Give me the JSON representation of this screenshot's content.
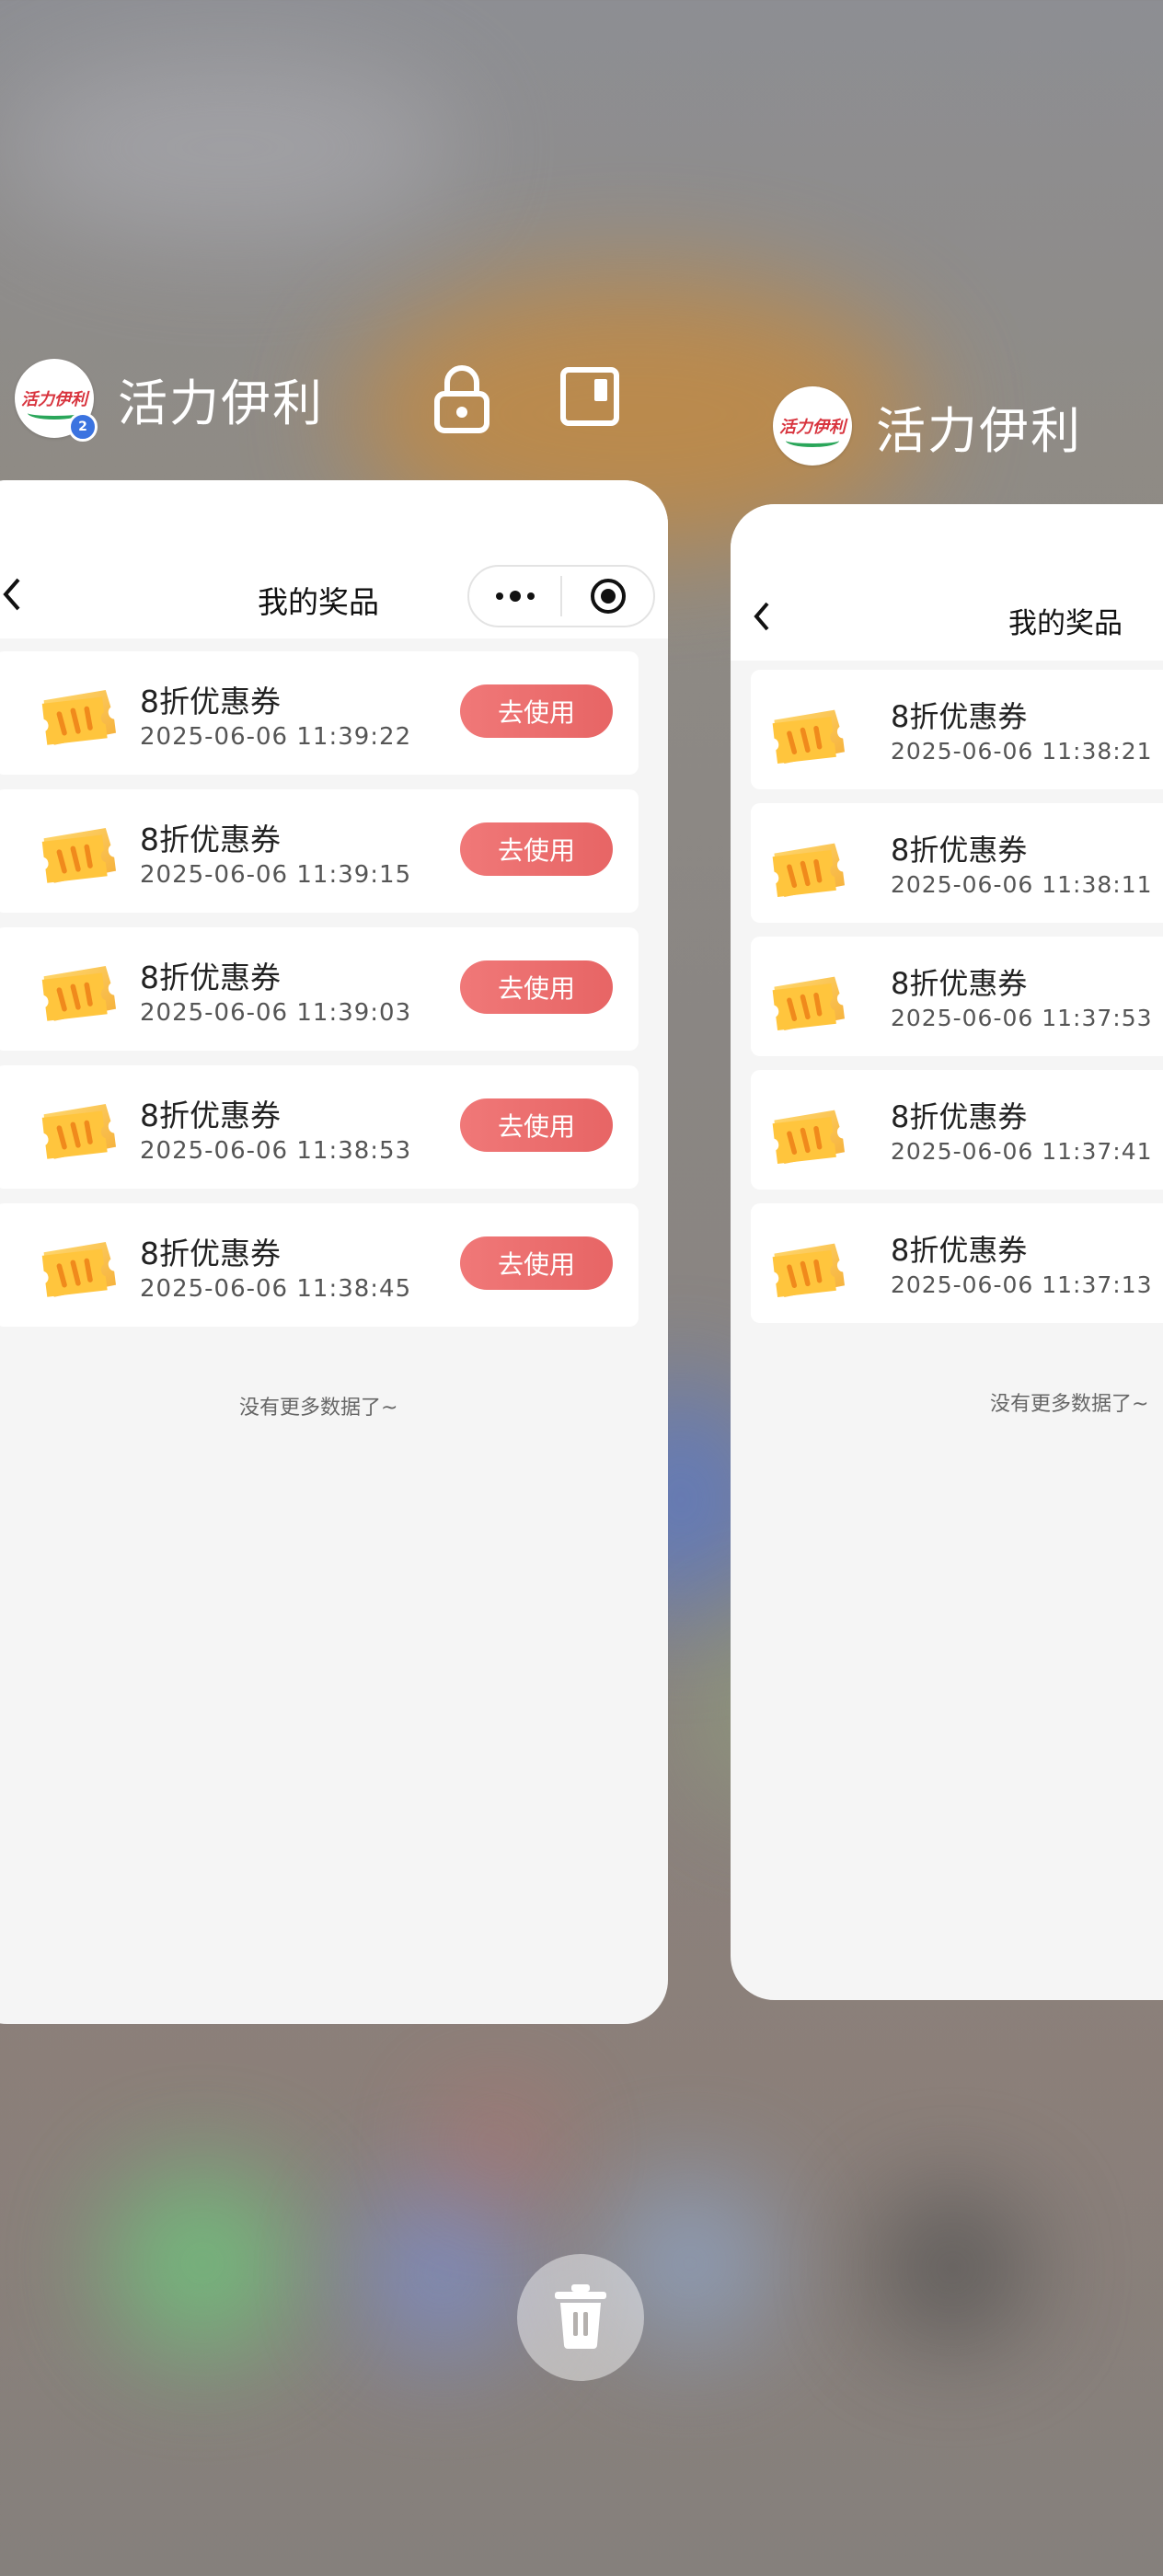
{
  "app": {
    "name": "活力伊利",
    "logo_text": "活力伊利",
    "badge": "2",
    "icons": [
      "lock-icon",
      "split-screen-icon"
    ]
  },
  "left_card": {
    "nav_title": "我的奖品",
    "items": [
      {
        "title": "8折优惠券",
        "time": "2025-06-06 11:39:22",
        "button": "去使用"
      },
      {
        "title": "8折优惠券",
        "time": "2025-06-06 11:39:15",
        "button": "去使用"
      },
      {
        "title": "8折优惠券",
        "time": "2025-06-06 11:39:03",
        "button": "去使用"
      },
      {
        "title": "8折优惠券",
        "time": "2025-06-06 11:38:53",
        "button": "去使用"
      },
      {
        "title": "8折优惠券",
        "time": "2025-06-06 11:38:45",
        "button": "去使用"
      }
    ],
    "footer": "没有更多数据了~"
  },
  "right_card": {
    "nav_title": "我的奖品",
    "items": [
      {
        "title": "8折优惠券",
        "time": "2025-06-06 11:38:21"
      },
      {
        "title": "8折优惠券",
        "time": "2025-06-06 11:38:11"
      },
      {
        "title": "8折优惠券",
        "time": "2025-06-06 11:37:53"
      },
      {
        "title": "8折优惠券",
        "time": "2025-06-06 11:37:41"
      },
      {
        "title": "8折优惠券",
        "time": "2025-06-06 11:37:13"
      }
    ],
    "footer": "没有更多数据了~"
  },
  "colors": {
    "use_button": "#e96b6b",
    "ticket": "#f7b733",
    "badge": "#3b73e0"
  },
  "trash_icon": "trash-icon"
}
